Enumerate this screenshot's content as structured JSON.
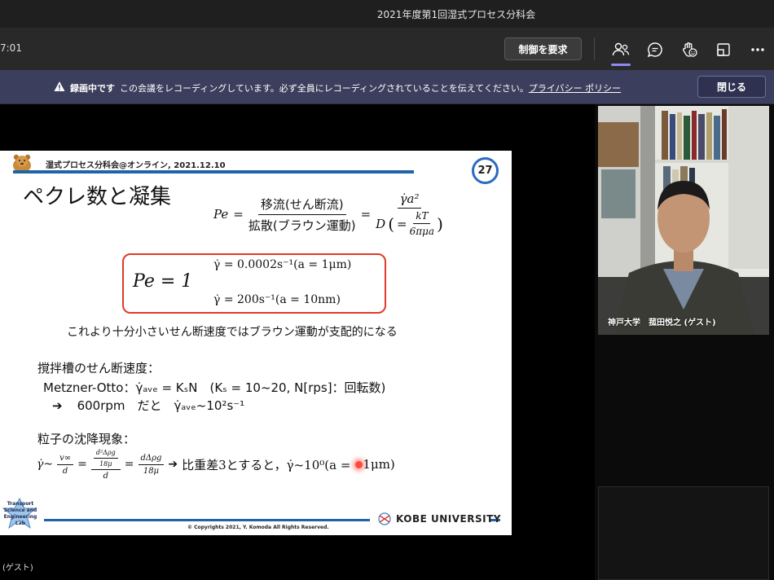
{
  "window": {
    "title": "2021年度第1回湿式プロセス分科会"
  },
  "toolbar": {
    "timer": "7:01",
    "request_control_label": "制御を要求",
    "icons": [
      "people-icon",
      "chat-icon",
      "reactions-icon",
      "rooms-icon",
      "more-icon"
    ]
  },
  "banner": {
    "bold": "録画中です",
    "message": "この会議をレコーディングしています。必ず全員にレコーディングされていることを伝えてください。",
    "link": "プライバシー ポリシー",
    "close_label": "閉じる"
  },
  "slide": {
    "header": "湿式プロセス分科会@オンライン, 2021.12.10",
    "page": "27",
    "heading": "ペクレ数と凝集",
    "eq_pe_lhs": "Pe",
    "eq_num": "移流(せん断流)",
    "eq_den": "拡散(ブラウン運動)",
    "eq_rhs_num": "γ̇a²",
    "eq_rhs_den_D": "D",
    "eq_rhs_den_inner_num": "kT",
    "eq_rhs_den_inner_den": "6πμa",
    "pe_one": "Pe = 1",
    "gamma1": "γ̇ = 0.0002s⁻¹(a = 1μm)",
    "gamma2": "γ̇ = 200s⁻¹(a = 10nm)",
    "note": "これより十分小さいせん断速度ではブラウン運動が支配的になる",
    "section1": "撹拌槽のせん断速度：",
    "metzner": "Metzner-Otto：γ̇ₐᵥₑ = KₛN　(Kₛ = 10~20, N[rps]：回転数)",
    "arrow_text": "600rpm　だと　γ̇ₐᵥₑ~10²s⁻¹",
    "section2": "粒子の沈降現象：",
    "sed_lhs": "γ̇~",
    "sed_f1_num": "v∞",
    "sed_f1_den": "d",
    "sed_f2_num_top": "d²Δρg",
    "sed_f2_num_bot": "18μ",
    "sed_f2_den": "d",
    "sed_f3_num": "dΔρg",
    "sed_f3_den": "18μ",
    "sed_tail_a": "比重差3とすると，γ̇~10⁰(a = ",
    "sed_tail_b": "1μm)",
    "copyright": "© Copyrights 2021, Y. Komoda All Rights Reserved.",
    "university": "KOBE UNIVERSITY",
    "lab_logo_text": "Transport Science and Engineering Lab"
  },
  "stage": {
    "presenter_suffix": "(ゲスト)"
  },
  "video": {
    "participant_name": "神戸大学　菰田悦之 (ゲスト)"
  }
}
